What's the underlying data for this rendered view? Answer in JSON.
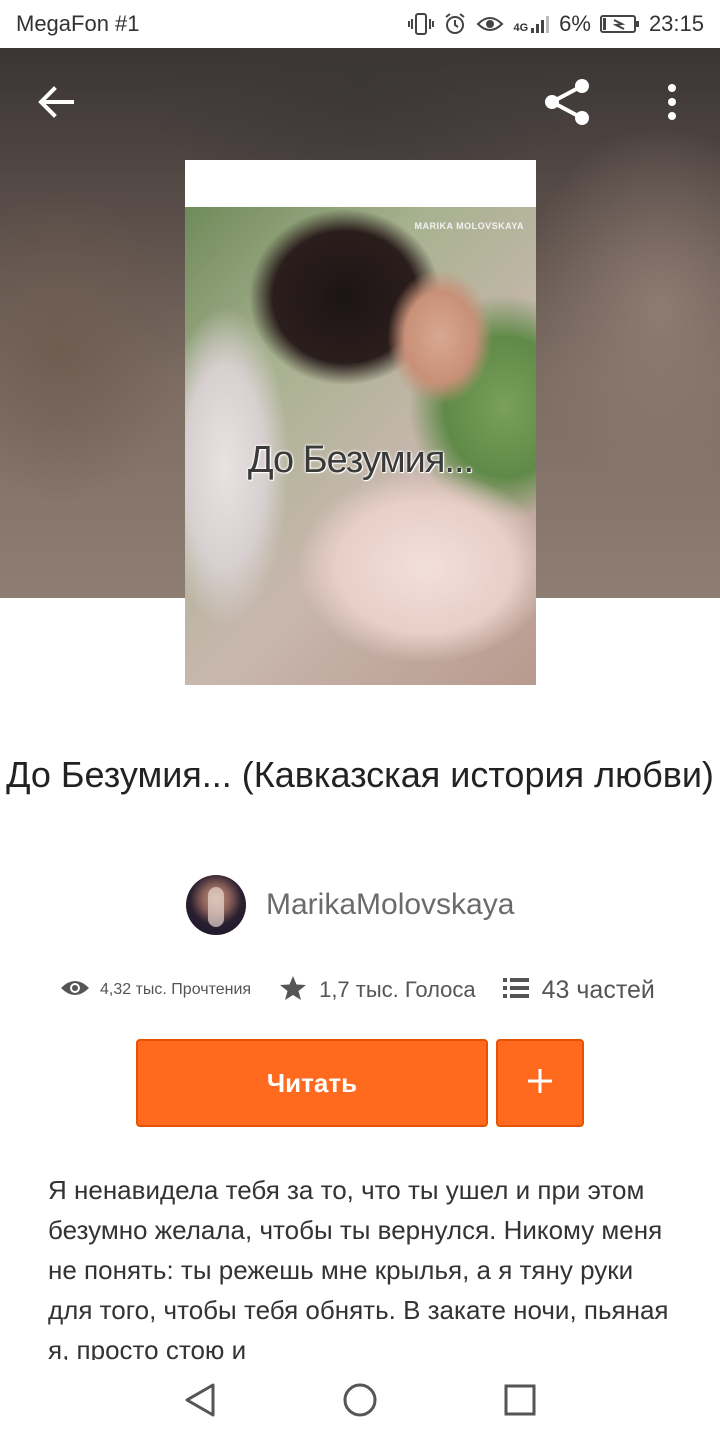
{
  "status_bar": {
    "carrier": "MegaFon #1",
    "network": "4G",
    "battery": "6%",
    "time": "23:15",
    "icons": [
      "vibrate-icon",
      "alarm-icon",
      "eye-icon",
      "signal-icon",
      "battery-icon"
    ]
  },
  "toolbar": {
    "back_icon": "arrow-back-icon",
    "share_icon": "share-icon",
    "more_icon": "more-vertical-icon"
  },
  "cover": {
    "author_mark": "MARIKA MOLOVSKAYA",
    "title": "До Безумия..."
  },
  "story": {
    "title": "До Безумия... (Кавказская история любви)",
    "author": "MarikaMolovskaya"
  },
  "stats": {
    "views": "4,32 тыс. Прочтения",
    "votes": "1,7 тыс. Голоса",
    "parts": "43 частей"
  },
  "actions": {
    "read_label": "Читать",
    "add_label": "+"
  },
  "description": "Я ненавидела тебя за то, что ты ушел и при этом безумно  желала, чтобы ты вернулся. Никому меня не понять: ты режешь мне крылья, а я тяну руки для того, чтобы тебя обнять. В закате ночи, пьяная я, просто стою и",
  "colors": {
    "accent": "#ff6a1f",
    "accent_border": "#e65300",
    "text_primary": "#222222",
    "text_secondary": "#6b6b6b"
  }
}
